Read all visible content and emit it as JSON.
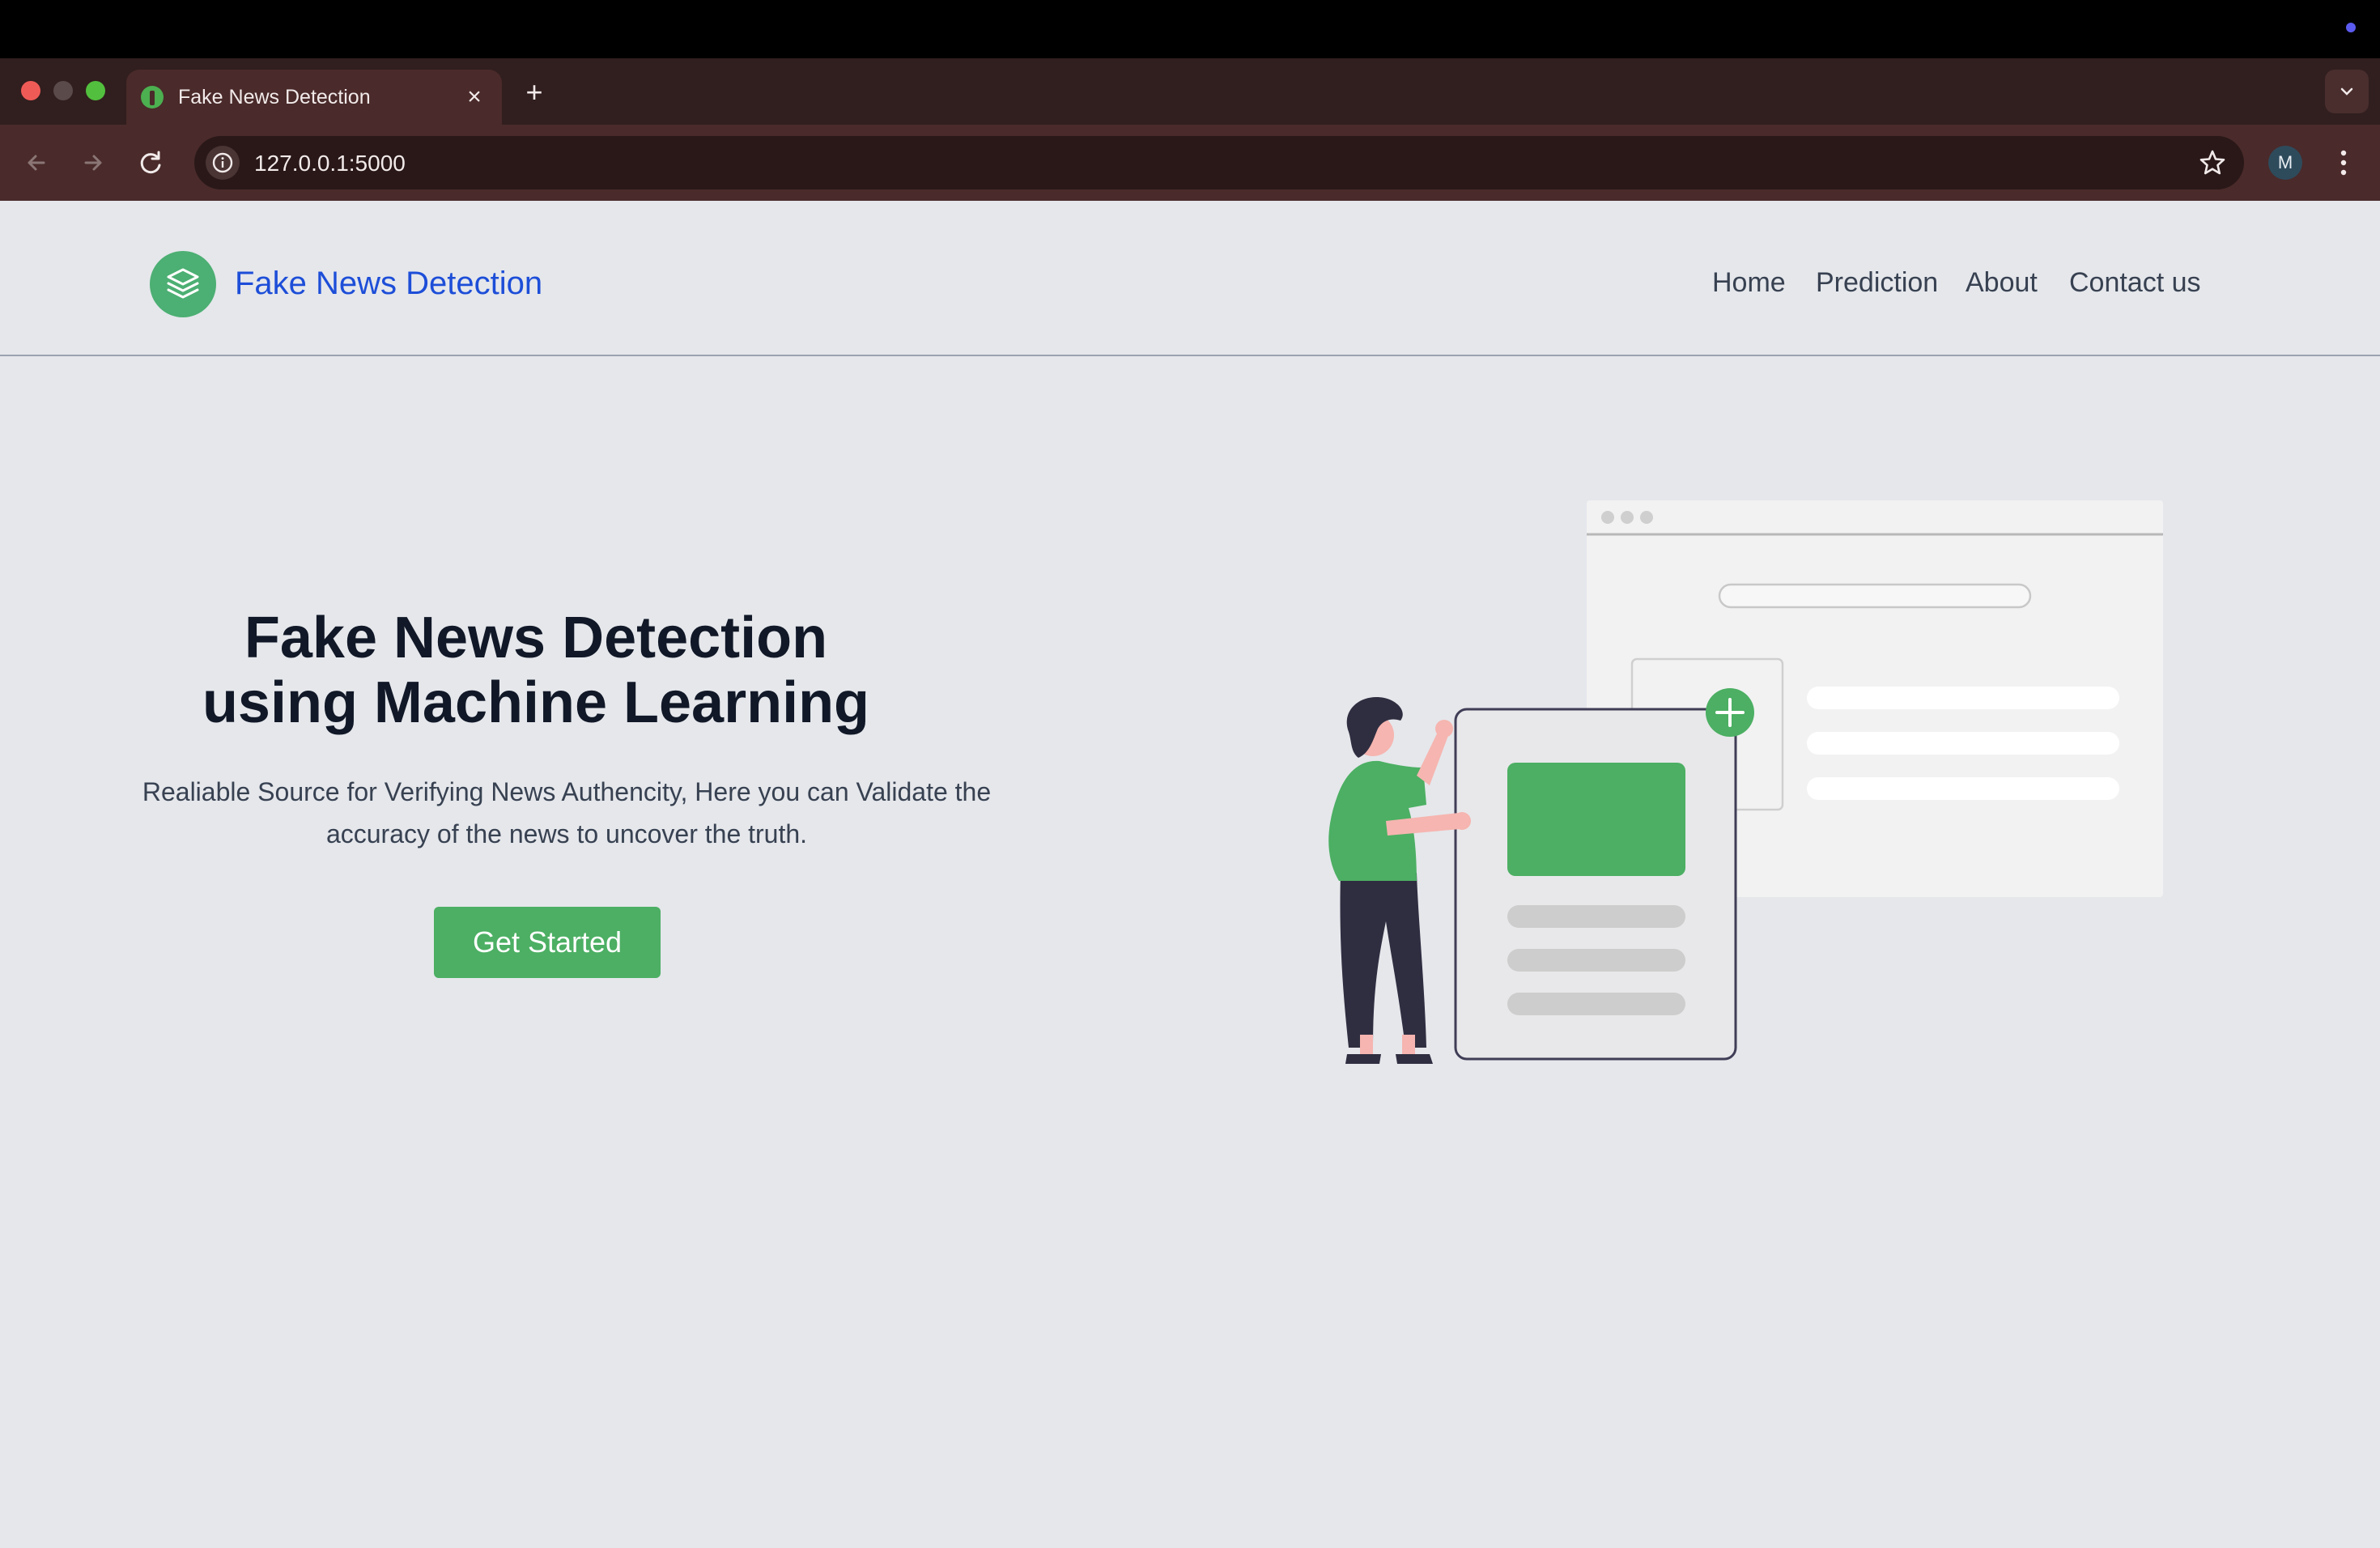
{
  "browser": {
    "tab_title": "Fake News Detection",
    "tab_close": "×",
    "new_tab": "+",
    "url": "127.0.0.1:5000",
    "profile_initial": "M"
  },
  "site": {
    "brand": "Fake News Detection",
    "nav": [
      "Home",
      "Prediction",
      "About",
      "Contact us"
    ]
  },
  "hero": {
    "title_line1": "Fake News Detection",
    "title_line2": "using Machine Learning",
    "subtitle": "Realiable Source for Verifying News Authencity, Here you can Validate the accuracy of the news to uncover the truth.",
    "cta_label": "Get Started"
  },
  "colors": {
    "accent_green": "#4caf63",
    "brand_blue": "#1d4ed8",
    "page_bg": "#e5e7eb"
  },
  "icons": [
    "back-arrow-icon",
    "forward-arrow-icon",
    "reload-icon",
    "site-info-icon",
    "bookmark-star-icon",
    "kebab-menu-icon",
    "tab-list-chevron-icon",
    "layers-logo-icon"
  ]
}
